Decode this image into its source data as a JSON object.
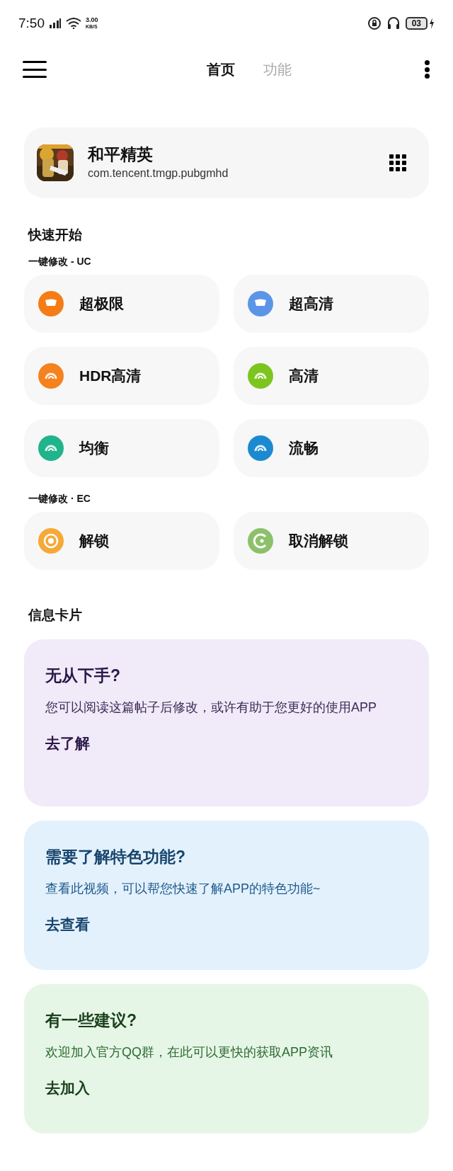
{
  "status_bar": {
    "time": "7:50",
    "speed_value": "3.00",
    "speed_unit": "KB/S",
    "battery": "03"
  },
  "tabs": [
    {
      "label": "首页",
      "selected": true
    },
    {
      "label": "功能",
      "selected": false
    }
  ],
  "app_card": {
    "name": "和平精英",
    "package": "com.tencent.tmgp.pubgmhd"
  },
  "quick_start": {
    "title": "快速开始",
    "groups": [
      {
        "label": "一键修改 - UC",
        "items": [
          {
            "label": "超极限",
            "color": "#f57c14",
            "kind": "gauge-full"
          },
          {
            "label": "超高清",
            "color": "#5b95e8",
            "kind": "gauge-full"
          },
          {
            "label": "HDR高清",
            "color": "#f5821e",
            "kind": "gauge"
          },
          {
            "label": "高清",
            "color": "#7cc51f",
            "kind": "gauge"
          },
          {
            "label": "均衡",
            "color": "#1fb48c",
            "kind": "gauge"
          },
          {
            "label": "流畅",
            "color": "#1c8ad0",
            "kind": "gauge"
          }
        ]
      },
      {
        "label": "一键修改 · EC",
        "items": [
          {
            "label": "解锁",
            "color": "#f5a936",
            "kind": "ring"
          },
          {
            "label": "取消解锁",
            "color": "#8dc06a",
            "kind": "open-ring"
          }
        ]
      }
    ]
  },
  "info": {
    "title": "信息卡片",
    "cards": [
      {
        "color": "#f1eaf8",
        "title": "无从下手?",
        "body": "您可以阅读这篇帖子后修改，或许有助于您更好的使用APP",
        "action": "去了解"
      },
      {
        "color": "#e3f1fd",
        "title": "需要了解特色功能?",
        "body": "查看此视频，可以帮您快速了解APP的特色功能~",
        "action": "去查看"
      },
      {
        "color": "#e6f6e6",
        "title": "有一些建议?",
        "body": "欢迎加入官方QQ群，在此可以更快的获取APP资讯",
        "action": "去加入"
      }
    ]
  }
}
